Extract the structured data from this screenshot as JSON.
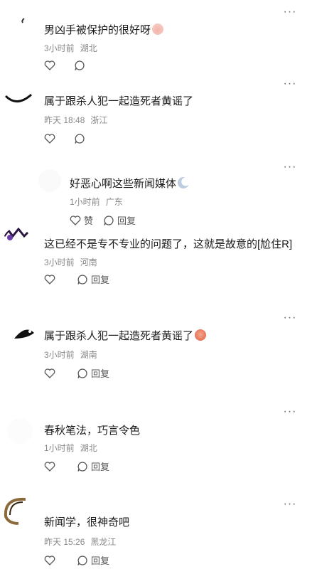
{
  "more_label": "···",
  "actions": {
    "like_label": "赞",
    "reply_label": "回复"
  },
  "comments": [
    {
      "text": "男凶手被保护的很好呀",
      "time": "3小时前",
      "location": "湖北",
      "emoji": "peach-emoji"
    },
    {
      "text": "属于跟杀人犯一起造死者黄谣了",
      "time": "昨天 18:48",
      "location": "浙江"
    },
    {
      "text": "好恶心啊这些新闻媒体",
      "time": "1小时前",
      "location": "广东"
    },
    {
      "text": "这已经不是专不专业的问题了，这就是故意的[尬住R]",
      "time": "3小时前",
      "location": "河南"
    },
    {
      "text": "属于跟杀人犯一起造死者黄谣了",
      "time": "3小时前",
      "location": "湖南",
      "emoji": "angry-face-emoji"
    },
    {
      "text": "春秋笔法，巧言令色",
      "time": "1小时前",
      "location": "湖北"
    },
    {
      "text": "新闻学，很神奇吧",
      "time": "昨天 15:26",
      "location": "黑龙江"
    }
  ]
}
